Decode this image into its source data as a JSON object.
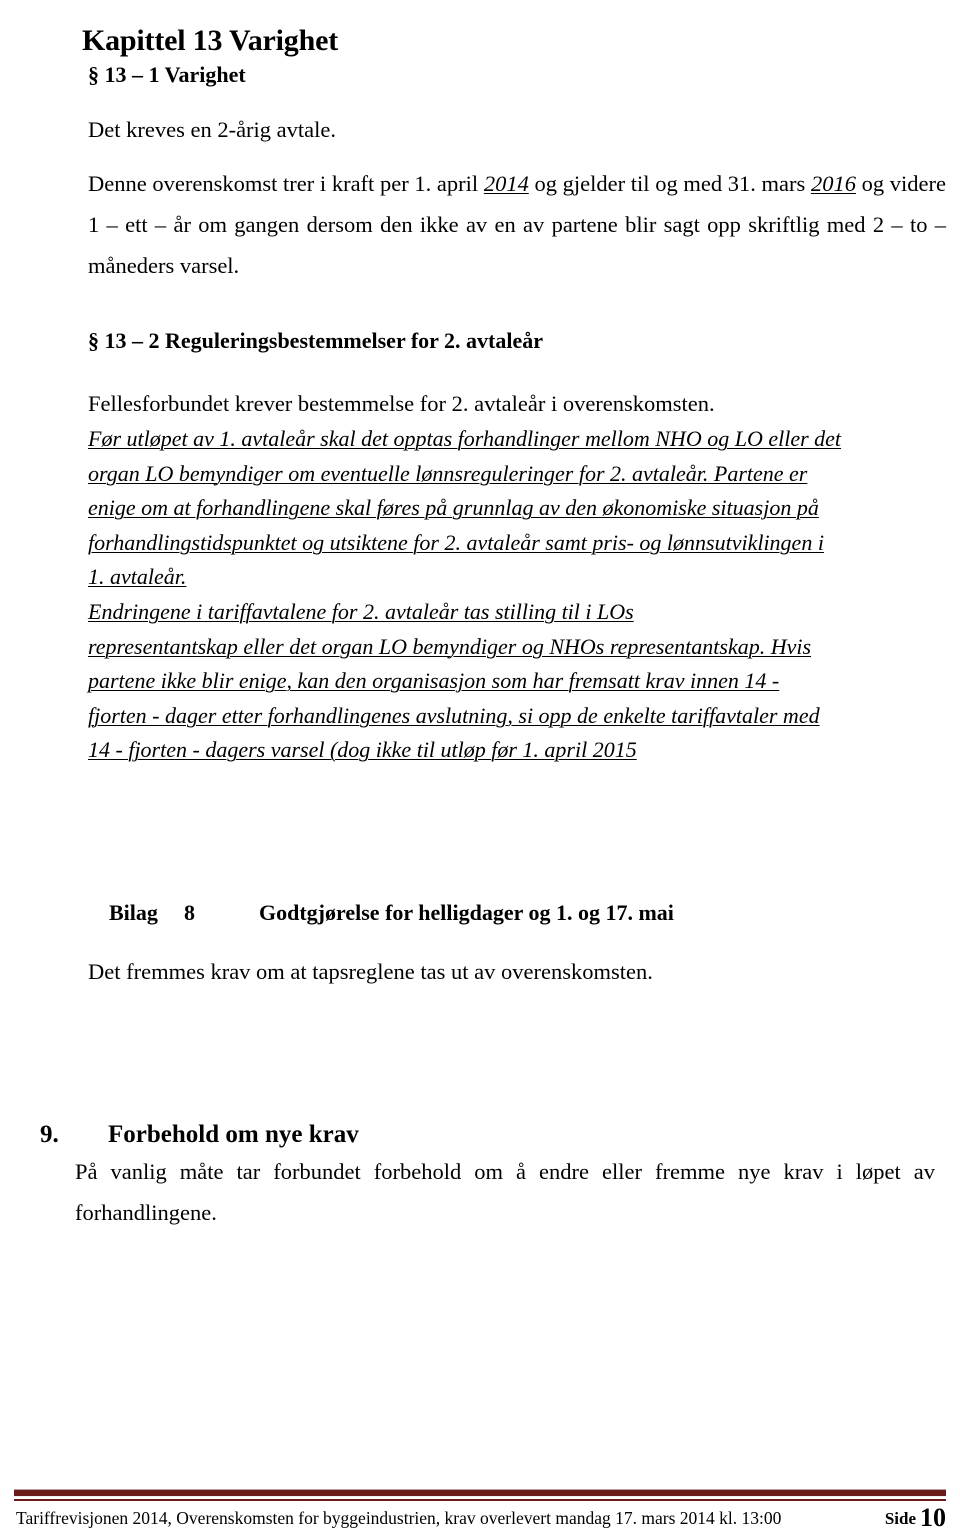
{
  "document": {
    "chapter_heading": "Kapittel 13 Varighet",
    "section_13_1_heading": "§ 13 – 1 Varighet",
    "para_kreves": "Det kreves en 2-årig avtale.",
    "para_denne": {
      "part1": "Denne overenskomst trer i kraft per 1. april ",
      "year_from": "2014",
      "part2": " og gjelder til og med 31. mars ",
      "year_to": "2016",
      "part3": " og videre 1 – ett – år om gangen dersom den ikke av en av partene blir sagt opp skriftlig med 2 – to – måneders varsel."
    },
    "section_13_2_heading": "§ 13 – 2 Reguleringsbestemmelser for 2. avtaleår",
    "para_fellesforbundet": "Fellesforbundet krever bestemmelse for 2. avtaleår i overenskomsten.",
    "italic_block_lines": [
      "Før utløpet av 1. avtaleår skal det opptas forhandlinger mellom NHO og LO eller det",
      "organ LO bemyndiger om eventuelle lønnsreguleringer for 2. avtaleår. Partene er",
      "enige om at forhandlingene skal føres på grunnlag av den økonomiske situasjon på",
      "forhandlingstidspunktet og utsiktene for 2. avtaleår samt pris- og lønnsutviklingen i",
      "1. avtaleår.",
      "Endringene i tariffavtalene for 2. avtaleår tas stilling til i LOs",
      "representantskap eller det organ LO bemyndiger og NHOs representantskap. Hvis",
      "partene ikke blir enige, kan den organisasjon som har fremsatt krav innen 14 -",
      "fjorten - dager etter forhandlingenes avslutning, si opp de enkelte tariffavtaler med",
      "14 - fjorten - dagers varsel (dog ikke til utløp før 1. april 2015"
    ],
    "bilag": {
      "label": "Bilag",
      "number": "8",
      "title": "Godtgjørelse for helligdager og 1. og 17. mai"
    },
    "para_tapsreglene": "Det fremmes krav om at tapsreglene tas ut av overenskomsten.",
    "section_9": {
      "number": "9.",
      "title": "Forbehold om nye krav"
    },
    "para_forbehold": "På vanlig måte tar forbundet forbehold om å endre eller fremme nye krav i løpet av forhandlingene.",
    "footer": {
      "text": "Tariffrevisjonen 2014, Overenskomsten for byggeindustrien, krav overlevert mandag 17. mars 2014 kl. 13:00",
      "page_label": "Side",
      "page_number": "10",
      "rule_color": "#6b1a1a"
    }
  }
}
